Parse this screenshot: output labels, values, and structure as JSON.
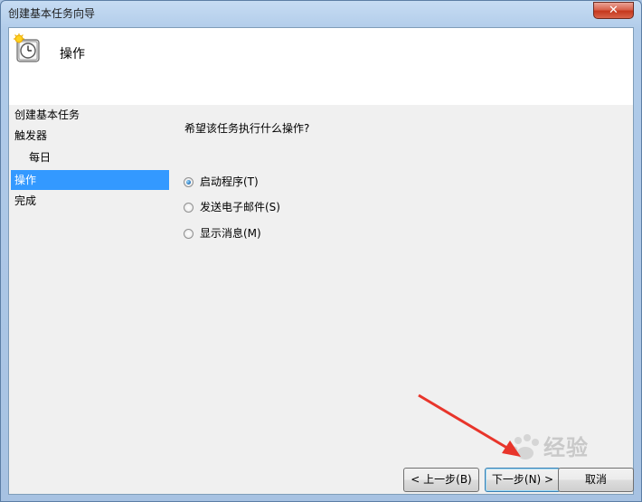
{
  "window": {
    "title": "创建基本任务向导",
    "close_glyph": "✕"
  },
  "header": {
    "title": "操作",
    "icon": "task-clock-icon"
  },
  "nav": {
    "items": [
      {
        "label": "创建基本任务",
        "selected": false
      },
      {
        "label": "触发器",
        "selected": false
      },
      {
        "label": "每日",
        "selected": false
      },
      {
        "label": "操作",
        "selected": true
      },
      {
        "label": "完成",
        "selected": false
      }
    ]
  },
  "main": {
    "question": "希望该任务执行什么操作?",
    "options": [
      {
        "label": "启动程序(T)",
        "checked": true
      },
      {
        "label": "发送电子邮件(S)",
        "checked": false
      },
      {
        "label": "显示消息(M)",
        "checked": false
      }
    ]
  },
  "buttons": {
    "back": "< 上一步(B)",
    "next": "下一步(N) >",
    "cancel": "取消"
  },
  "colors": {
    "selection": "#3399ff",
    "annotation_arrow": "#e8352b"
  },
  "watermark": {
    "text": "经验"
  }
}
